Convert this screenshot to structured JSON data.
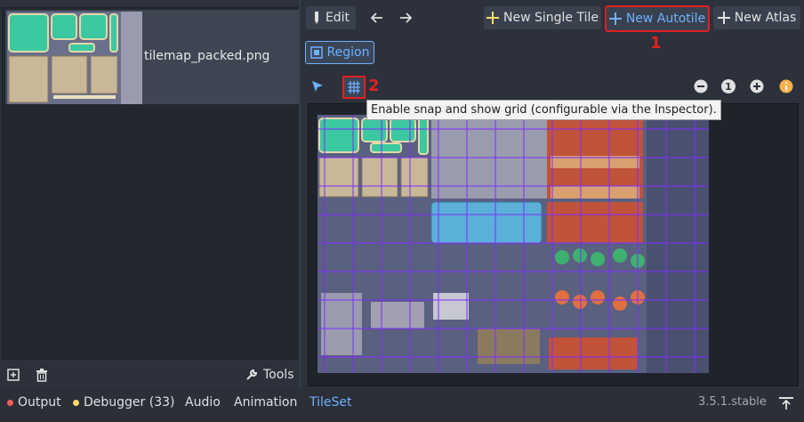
{
  "left_panel": {
    "texture_name": "tilemap_packed.png",
    "tools_label": "Tools"
  },
  "toolbar": {
    "edit_label": "Edit",
    "new_single_tile_label": "New Single Tile",
    "new_autotile_label": "New Autotile",
    "new_atlas_label": "New Atlas",
    "region_label": "Region",
    "zoom_reset_label": "1"
  },
  "annotations": {
    "marker_1": "1",
    "marker_2": "2"
  },
  "tooltip": {
    "text": "Enable snap and show grid (configurable via the Inspector)."
  },
  "bottom_bar": {
    "output_label": "Output",
    "debugger_label": "Debugger (33)",
    "audio_label": "Audio",
    "animation_label": "Animation",
    "tileset_label": "TileSet",
    "version": "3.5.1.stable"
  },
  "colors": {
    "accent": "#6fb1ff",
    "highlight_red": "#e02020",
    "output_dot": "#ff5d5d",
    "debugger_dot": "#ffd966",
    "grid": "#7d2cff"
  },
  "icons": [
    "add-icon",
    "trash-icon",
    "wrench-icon",
    "pencil-icon",
    "arrow-left-icon",
    "arrow-right-icon",
    "plus-icon",
    "region-icon",
    "pointer-icon",
    "grid-snap-icon",
    "zoom-out-icon",
    "zoom-in-icon",
    "info-icon",
    "pin-icon"
  ]
}
